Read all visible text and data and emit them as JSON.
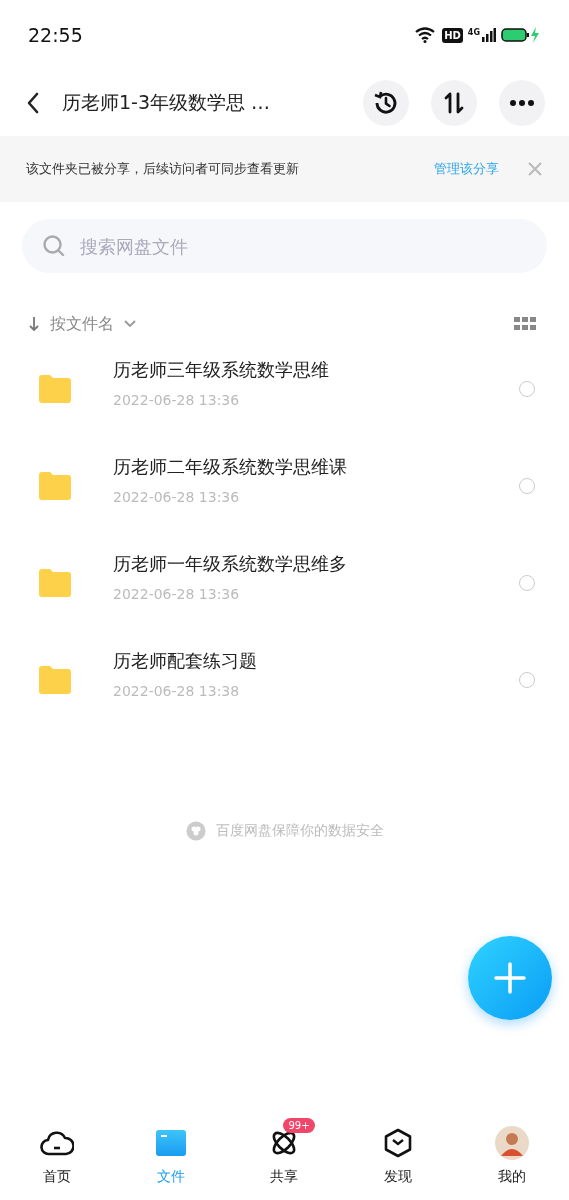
{
  "status_bar": {
    "time": "22:55",
    "hd_badge": "HD",
    "network": "4G"
  },
  "header": {
    "title": "历老师1-3年级数学思 …"
  },
  "share_banner": {
    "message": "该文件夹已被分享，后续访问者可同步查看更新",
    "link": "管理该分享"
  },
  "search": {
    "placeholder": "搜索网盘文件"
  },
  "sort": {
    "label": "按文件名"
  },
  "files": [
    {
      "name": "历老师三年级系统数学思维",
      "date": "2022-06-28  13:36",
      "selected": false
    },
    {
      "name": "历老师二年级系统数学思维课",
      "date": "2022-06-28  13:36",
      "selected": false
    },
    {
      "name": "历老师一年级系统数学思维多",
      "date": "2022-06-28  13:36",
      "selected": false
    },
    {
      "name": "历老师配套练习题",
      "date": "2022-06-28  13:38",
      "selected": false
    }
  ],
  "footer_note": "百度网盘保障你的数据安全",
  "nav": [
    {
      "kind": "home",
      "label": "首页",
      "selected": false
    },
    {
      "kind": "files",
      "label": "文件",
      "selected": true
    },
    {
      "kind": "share",
      "label": "共享",
      "selected": false,
      "badge": "99+"
    },
    {
      "kind": "discover",
      "label": "发现",
      "selected": false
    },
    {
      "kind": "me",
      "label": "我的",
      "selected": false
    }
  ]
}
